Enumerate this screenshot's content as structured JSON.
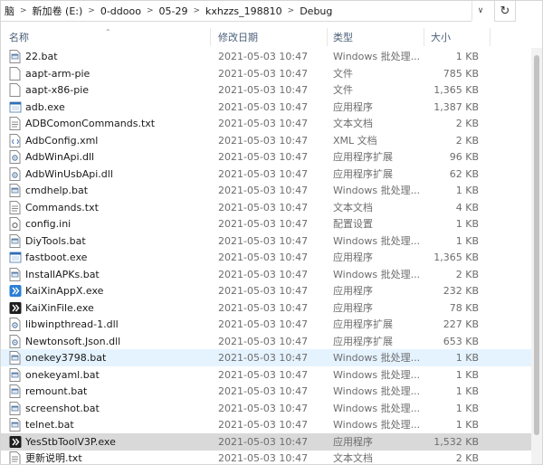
{
  "breadcrumb": [
    "脑",
    "新加卷 (E:)",
    "0-ddooo",
    "05-29",
    "kxhzzs_198810",
    "Debug"
  ],
  "columns": {
    "name": "名称",
    "date": "修改日期",
    "type": "类型",
    "size": "大小"
  },
  "files": [
    {
      "name": "22.bat",
      "date": "2021-05-03 10:47",
      "type": "Windows 批处理...",
      "size": "1 KB",
      "icon": "bat-icon"
    },
    {
      "name": "aapt-arm-pie",
      "date": "2021-05-03 10:47",
      "type": "文件",
      "size": "785 KB",
      "icon": "file-icon"
    },
    {
      "name": "aapt-x86-pie",
      "date": "2021-05-03 10:47",
      "type": "文件",
      "size": "1,365 KB",
      "icon": "file-icon"
    },
    {
      "name": "adb.exe",
      "date": "2021-05-03 10:47",
      "type": "应用程序",
      "size": "1,387 KB",
      "icon": "exe-icon"
    },
    {
      "name": "ADBComonCommands.txt",
      "date": "2021-05-03 10:47",
      "type": "文本文档",
      "size": "2 KB",
      "icon": "txt-icon"
    },
    {
      "name": "AdbConfig.xml",
      "date": "2021-05-03 10:47",
      "type": "XML 文档",
      "size": "2 KB",
      "icon": "xml-icon"
    },
    {
      "name": "AdbWinApi.dll",
      "date": "2021-05-03 10:47",
      "type": "应用程序扩展",
      "size": "96 KB",
      "icon": "dll-icon"
    },
    {
      "name": "AdbWinUsbApi.dll",
      "date": "2021-05-03 10:47",
      "type": "应用程序扩展",
      "size": "62 KB",
      "icon": "dll-icon"
    },
    {
      "name": "cmdhelp.bat",
      "date": "2021-05-03 10:47",
      "type": "Windows 批处理...",
      "size": "1 KB",
      "icon": "bat-icon"
    },
    {
      "name": "Commands.txt",
      "date": "2021-05-03 10:47",
      "type": "文本文档",
      "size": "4 KB",
      "icon": "txt-icon"
    },
    {
      "name": "config.ini",
      "date": "2021-05-03 10:47",
      "type": "配置设置",
      "size": "1 KB",
      "icon": "ini-icon"
    },
    {
      "name": "DiyTools.bat",
      "date": "2021-05-03 10:47",
      "type": "Windows 批处理...",
      "size": "1 KB",
      "icon": "bat-icon"
    },
    {
      "name": "fastboot.exe",
      "date": "2021-05-03 10:47",
      "type": "应用程序",
      "size": "1,365 KB",
      "icon": "exe-icon"
    },
    {
      "name": "InstallAPKs.bat",
      "date": "2021-05-03 10:47",
      "type": "Windows 批处理...",
      "size": "2 KB",
      "icon": "bat-icon"
    },
    {
      "name": "KaiXinAppX.exe",
      "date": "2021-05-03 10:47",
      "type": "应用程序",
      "size": "232 KB",
      "icon": "app-blue-icon"
    },
    {
      "name": "KaiXinFile.exe",
      "date": "2021-05-03 10:47",
      "type": "应用程序",
      "size": "78 KB",
      "icon": "app-dark-icon"
    },
    {
      "name": "libwinpthread-1.dll",
      "date": "2021-05-03 10:47",
      "type": "应用程序扩展",
      "size": "227 KB",
      "icon": "dll-icon"
    },
    {
      "name": "Newtonsoft.Json.dll",
      "date": "2021-05-03 10:47",
      "type": "应用程序扩展",
      "size": "653 KB",
      "icon": "dll-icon"
    },
    {
      "name": "onekey3798.bat",
      "date": "2021-05-03 10:47",
      "type": "Windows 批处理...",
      "size": "1 KB",
      "icon": "bat-icon",
      "state": "hover"
    },
    {
      "name": "onekeyaml.bat",
      "date": "2021-05-03 10:47",
      "type": "Windows 批处理...",
      "size": "1 KB",
      "icon": "bat-icon"
    },
    {
      "name": "remount.bat",
      "date": "2021-05-03 10:47",
      "type": "Windows 批处理...",
      "size": "1 KB",
      "icon": "bat-icon"
    },
    {
      "name": "screenshot.bat",
      "date": "2021-05-03 10:47",
      "type": "Windows 批处理...",
      "size": "1 KB",
      "icon": "bat-icon"
    },
    {
      "name": "telnet.bat",
      "date": "2021-05-03 10:47",
      "type": "Windows 批处理...",
      "size": "1 KB",
      "icon": "bat-icon"
    },
    {
      "name": "YesStbToolV3P.exe",
      "date": "2021-05-03 10:47",
      "type": "应用程序",
      "size": "1,532 KB",
      "icon": "app-dark-icon",
      "state": "selected"
    },
    {
      "name": "更新说明.txt",
      "date": "2021-05-03 10:47",
      "type": "文本文档",
      "size": "2 KB",
      "icon": "txt-icon"
    }
  ]
}
